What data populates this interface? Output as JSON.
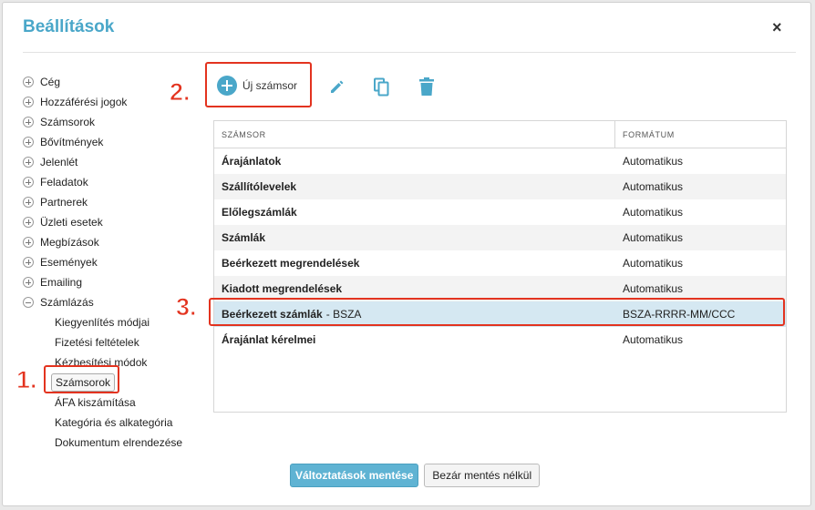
{
  "dialog": {
    "title": "Beállítások",
    "close_label": "×"
  },
  "sidebar": {
    "items": [
      {
        "label": "Cég",
        "state": "collapsed"
      },
      {
        "label": "Hozzáférési jogok",
        "state": "collapsed"
      },
      {
        "label": "Számsorok",
        "state": "collapsed"
      },
      {
        "label": "Bővítmények",
        "state": "collapsed"
      },
      {
        "label": "Jelenlét",
        "state": "collapsed"
      },
      {
        "label": "Feladatok",
        "state": "collapsed"
      },
      {
        "label": "Partnerek",
        "state": "collapsed"
      },
      {
        "label": "Üzleti esetek",
        "state": "collapsed"
      },
      {
        "label": "Megbízások",
        "state": "collapsed"
      },
      {
        "label": "Események",
        "state": "collapsed"
      },
      {
        "label": "Emailing",
        "state": "collapsed"
      },
      {
        "label": "Számlázás",
        "state": "expanded"
      }
    ],
    "subitems": [
      {
        "label": "Kiegyenlítés módjai"
      },
      {
        "label": "Fizetési feltételek"
      },
      {
        "label": "Kézbesítési módok"
      },
      {
        "label": "Számsorok",
        "selected": true
      },
      {
        "label": "ÁFA kiszámítása"
      },
      {
        "label": "Kategória és alkategória"
      },
      {
        "label": "Dokumentum elrendezése"
      }
    ]
  },
  "toolbar": {
    "new_label": "Új számsor",
    "edit_icon": "pencil-icon",
    "copy_icon": "copy-icon",
    "delete_icon": "trash-icon"
  },
  "table": {
    "headers": [
      "SZÁMSOR",
      "FORMÁTUM"
    ],
    "rows": [
      {
        "name": "Árajánlatok",
        "suffix": "",
        "format": "Automatikus"
      },
      {
        "name": "Szállítólevelek",
        "suffix": "",
        "format": "Automatikus"
      },
      {
        "name": "Előlegszámlák",
        "suffix": "",
        "format": "Automatikus"
      },
      {
        "name": "Számlák",
        "suffix": "",
        "format": "Automatikus"
      },
      {
        "name": "Beérkezett megrendelések",
        "suffix": "",
        "format": "Automatikus"
      },
      {
        "name": "Kiadott megrendelések",
        "suffix": "",
        "format": "Automatikus"
      },
      {
        "name": "Beérkezett számlák",
        "suffix": "- BSZA",
        "format": "BSZA-RRRR-MM/CCC",
        "selected": true
      },
      {
        "name": "Árajánlat kérelmei",
        "suffix": "",
        "format": "Automatikus"
      }
    ]
  },
  "annotations": {
    "step1": "1.",
    "step2": "2.",
    "step3": "3."
  },
  "footer": {
    "save_label": "Változtatások mentése",
    "close_label": "Bezár mentés nélkül"
  },
  "colors": {
    "accent": "#4aa7c9",
    "highlight": "#e3331f",
    "selected_row": "#d5e8f2"
  }
}
